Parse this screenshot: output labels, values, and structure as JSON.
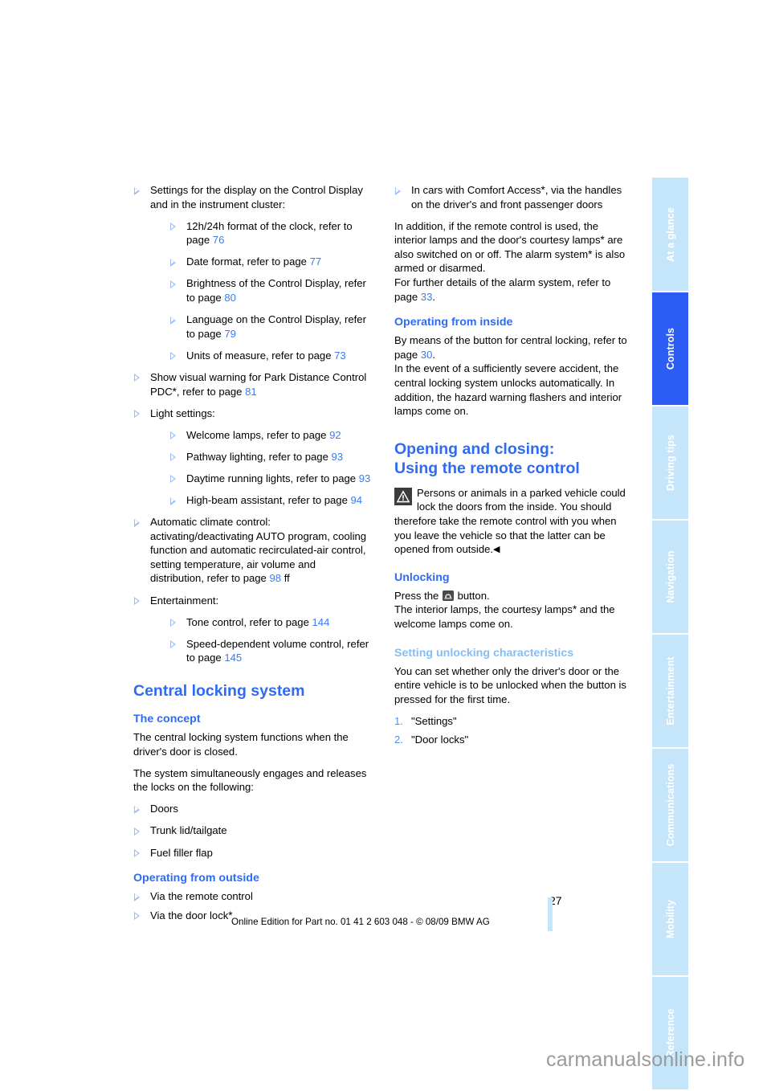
{
  "document": {
    "page_number": "27",
    "footer_text": "Online Edition for Part no. 01 41 2 603 048 - © 08/09 BMW AG",
    "watermark": "carmanualsonline.info"
  },
  "tabs": [
    {
      "label": "At a glance",
      "active": false
    },
    {
      "label": "Controls",
      "active": true
    },
    {
      "label": "Driving tips",
      "active": false
    },
    {
      "label": "Navigation",
      "active": false
    },
    {
      "label": "Entertainment",
      "active": false
    },
    {
      "label": "Communications",
      "active": false
    },
    {
      "label": "Mobility",
      "active": false
    },
    {
      "label": "Reference",
      "active": false
    }
  ],
  "left_column": {
    "bullets": [
      {
        "text": "Settings for the display on the Control Display and in the instrument cluster:",
        "sub": [
          {
            "text": "12h/24h format of the clock, refer to page ",
            "page": "76"
          },
          {
            "text": "Date format, refer to page ",
            "page": "77"
          },
          {
            "text": "Brightness of the Control Display, refer to page ",
            "page": "80"
          },
          {
            "text": "Language on the Control Display, refer to page ",
            "page": "79"
          },
          {
            "text": "Units of measure, refer to page ",
            "page": "73"
          }
        ]
      },
      {
        "text_pre": "Show visual warning for Park Distance Control PDC",
        "star": "*",
        "text_post": ", refer to page ",
        "page": "81"
      },
      {
        "text": "Light settings:",
        "sub": [
          {
            "text": "Welcome lamps, refer to page ",
            "page": "92"
          },
          {
            "text": "Pathway lighting, refer to page ",
            "page": "93"
          },
          {
            "text": "Daytime running lights, refer to page ",
            "page": "93"
          },
          {
            "text": "High-beam assistant, refer to page ",
            "page": "94"
          }
        ]
      },
      {
        "text": "Automatic climate control: activating/deactivating AUTO program, cooling function and automatic recirculated-air control, setting temperature, air volume and distribution, refer to page ",
        "page": "98",
        "suffix": " ff"
      },
      {
        "text": "Entertainment:",
        "sub": [
          {
            "text": "Tone control, refer to page ",
            "page": "144"
          },
          {
            "text": "Speed-dependent volume control, refer to page ",
            "page": "145"
          }
        ]
      }
    ],
    "section_title": "Central locking system",
    "concept": {
      "heading": "The concept",
      "p1": "The central locking system functions when the driver's door is closed.",
      "p2": "The system simultaneously engages and releases the locks on the following:",
      "items": [
        "Doors",
        "Trunk lid/tailgate",
        "Fuel filler flap"
      ]
    },
    "outside": {
      "heading": "Operating from outside",
      "items": [
        {
          "text": "Via the remote control",
          "star": ""
        },
        {
          "text": "Via the door lock",
          "star": "*"
        }
      ]
    }
  },
  "right_column": {
    "comfort_access_bullet": {
      "text_pre": "In cars with Comfort Access",
      "star": "*",
      "text_post": ", via the handles on the driver's and front passenger doors"
    },
    "p1_a": "In addition, if the remote control is used, the interior lamps and the door's courtesy lamps",
    "p1_star1": "*",
    "p1_b": " are also switched on or off. The alarm system",
    "p1_star2": "*",
    "p1_c": " is also armed or disarmed.",
    "p2_a": "For further details of the alarm system, refer to page ",
    "p2_page": "33",
    "p2_b": ".",
    "inside": {
      "heading": "Operating from inside",
      "p1_a": "By means of the button for central locking, refer to page ",
      "p1_page": "30",
      "p1_b": ".",
      "p2": "In the event of a sufficiently severe accident, the central locking system unlocks automatically. In addition, the hazard warning flashers and interior lamps come on."
    },
    "opening_closing": {
      "title_line1": "Opening and closing:",
      "title_line2": "Using the remote control",
      "warning_icon": "warning-triangle-icon",
      "warning_text": "Persons or animals in a parked vehicle could lock the doors from the inside. You should therefore take the remote control with you when you leave the vehicle so that the latter can be opened from outside.",
      "warning_end_mark": "◀"
    },
    "unlocking": {
      "heading": "Unlocking",
      "press_pre": "Press the ",
      "button_icon": "unlock-remote-button-icon",
      "press_post": " button.",
      "p_a": "The interior lamps, the courtesy lamps",
      "p_star": "*",
      "p_b": " and the welcome lamps come on."
    },
    "setting_unlocking": {
      "heading": "Setting unlocking characteristics",
      "p": "You can set whether only the driver's door or the entire vehicle is to be unlocked when the button is pressed for the first time.",
      "steps": [
        {
          "num": "1.",
          "label": "\"Settings\""
        },
        {
          "num": "2.",
          "label": "\"Door locks\""
        }
      ]
    }
  },
  "colors": {
    "heading_blue": "#2f6bf2",
    "light_heading_blue": "#86bdf0",
    "page_ref_blue": "#3a7bf0",
    "tab_inactive": "#c5e6fa",
    "tab_active": "#2b5df4",
    "bullet_triangle": "#9dbdf7"
  }
}
